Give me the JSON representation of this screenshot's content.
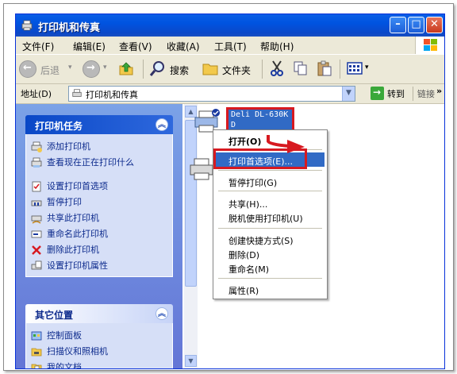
{
  "window": {
    "title": "打印机和传真"
  },
  "menubar": {
    "items": [
      "文件(F)",
      "编辑(E)",
      "查看(V)",
      "收藏(A)",
      "工具(T)",
      "帮助(H)"
    ]
  },
  "toolbar": {
    "back_label": "后退",
    "search_label": "搜索",
    "folders_label": "文件夹"
  },
  "address": {
    "label": "地址(D)",
    "value": "打印机和传真",
    "go_label": "转到",
    "links_label": "链接"
  },
  "tasks_panel": {
    "title": "打印机任务",
    "items": [
      "添加打印机",
      "查看现在正在打印什么",
      "设置打印首选项",
      "暂停打印",
      "共享此打印机",
      "重命名此打印机",
      "删除此打印机",
      "设置打印机属性"
    ]
  },
  "other_panel": {
    "title": "其它位置",
    "items": [
      "控制面板",
      "扫描仪和照相机",
      "我的文档"
    ]
  },
  "printer_item": {
    "name_line1": "Deli DL-630K",
    "name_line2": "D"
  },
  "context_menu": {
    "items": [
      {
        "label": "打开(O)",
        "bold": true
      },
      {
        "label": "打印首选项(E)...",
        "highlighted": true
      },
      {
        "label": "暂停打印(G)"
      },
      {
        "label": "共享(H)..."
      },
      {
        "label": "脱机使用打印机(U)"
      },
      {
        "label": "创建快捷方式(S)"
      },
      {
        "label": "删除(D)"
      },
      {
        "label": "重命名(M)"
      },
      {
        "label": "属性(R)"
      }
    ]
  },
  "colors": {
    "titlebar": "#0053e0",
    "highlight": "#316ac5",
    "annotation_red": "#d71920",
    "task_link": "#0c2a8c"
  }
}
